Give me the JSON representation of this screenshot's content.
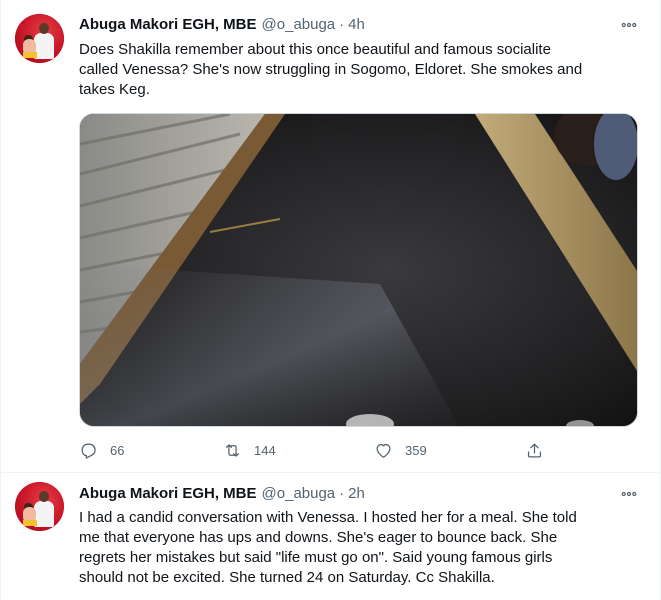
{
  "tweets": [
    {
      "author_name": "Abuga Makori EGH, MBE",
      "handle": "@o_abuga",
      "separator": "·",
      "time": "4h",
      "text": "Does Shakilla remember about this once beautiful and famous socialite\ncalled Venessa? She's now struggling in Sogomo, Eldoret. She smokes and\ntakes Keg.",
      "replies": "66",
      "retweets": "144",
      "likes": "359"
    },
    {
      "author_name": "Abuga Makori EGH, MBE",
      "handle": "@o_abuga",
      "separator": "·",
      "time": "2h",
      "text": "I had a candid conversation with Venessa. I hosted her for a meal. She told\nme that everyone has ups and downs. She's eager to bounce back. She\nregrets her mistakes but said \"life must go on\". Said young famous girls\nshould not be excited. She turned 24 on Saturday. Cc Shakilla."
    }
  ],
  "icons": {
    "more": "more-horizontal-icon",
    "reply": "reply-icon",
    "retweet": "retweet-icon",
    "like": "heart-icon",
    "share": "share-icon"
  },
  "colors": {
    "text_primary": "#0f1419",
    "text_secondary": "#536471",
    "border": "#eff3f4"
  }
}
